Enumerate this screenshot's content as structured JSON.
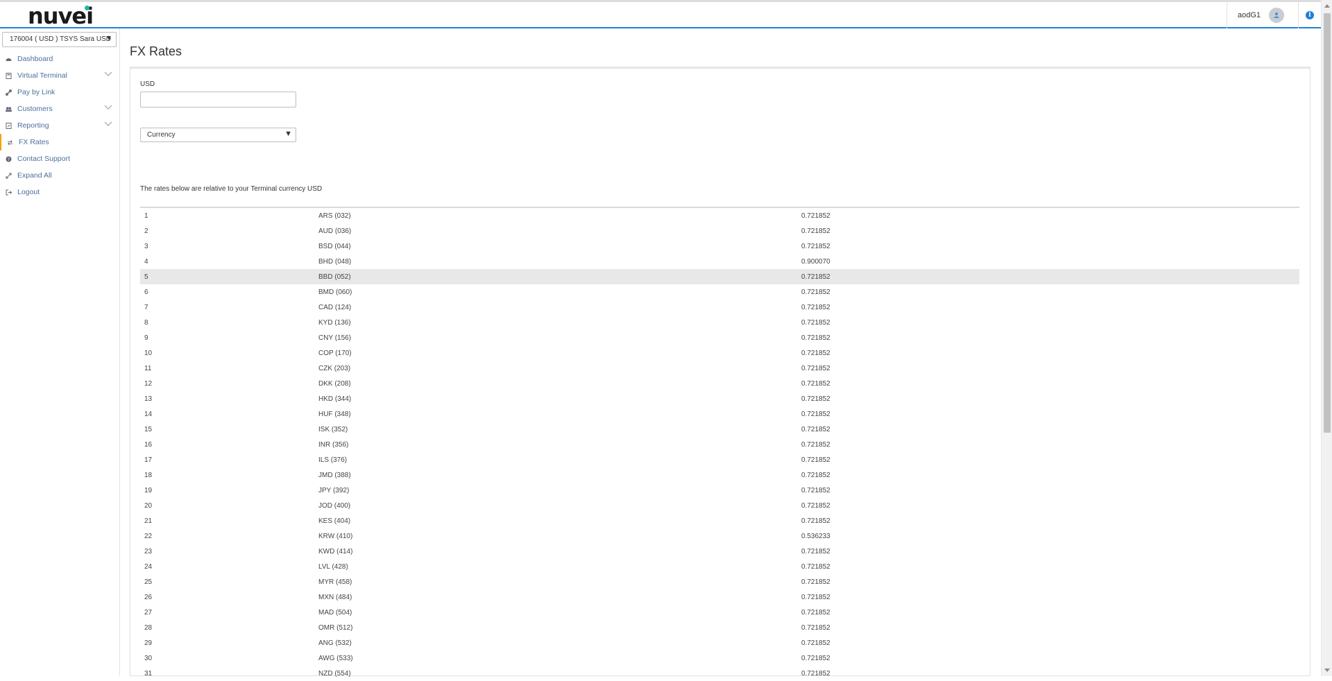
{
  "header": {
    "logo": "nuvei",
    "username": "aodG1"
  },
  "sidebar": {
    "terminal": "176004 ( USD ) TSYS Sara USD",
    "items": [
      {
        "label": "Dashboard",
        "icon": "dashboard-icon"
      },
      {
        "label": "Virtual Terminal",
        "icon": "calculator-icon"
      },
      {
        "label": "Pay by Link",
        "icon": "link-icon"
      },
      {
        "label": "Customers",
        "icon": "users-icon"
      },
      {
        "label": "Reporting",
        "icon": "report-icon"
      },
      {
        "label": "FX Rates",
        "icon": "exchange-icon"
      },
      {
        "label": "Contact Support",
        "icon": "help-icon"
      },
      {
        "label": "Expand All",
        "icon": "expand-icon"
      },
      {
        "label": "Logout",
        "icon": "logout-icon"
      }
    ]
  },
  "main": {
    "title": "FX Rates",
    "amount_label": "USD",
    "amount_value": "",
    "currency_select": "Currency",
    "note": "The rates below are relative to your Terminal currency USD"
  },
  "rates": [
    {
      "idx": "1",
      "code": "ARS (032)",
      "rate": "0.721852"
    },
    {
      "idx": "2",
      "code": "AUD (036)",
      "rate": "0.721852"
    },
    {
      "idx": "3",
      "code": "BSD (044)",
      "rate": "0.721852"
    },
    {
      "idx": "4",
      "code": "BHD (048)",
      "rate": "0.900070"
    },
    {
      "idx": "5",
      "code": "BBD (052)",
      "rate": "0.721852"
    },
    {
      "idx": "6",
      "code": "BMD (060)",
      "rate": "0.721852"
    },
    {
      "idx": "7",
      "code": "CAD (124)",
      "rate": "0.721852"
    },
    {
      "idx": "8",
      "code": "KYD (136)",
      "rate": "0.721852"
    },
    {
      "idx": "9",
      "code": "CNY (156)",
      "rate": "0.721852"
    },
    {
      "idx": "10",
      "code": "COP (170)",
      "rate": "0.721852"
    },
    {
      "idx": "11",
      "code": "CZK (203)",
      "rate": "0.721852"
    },
    {
      "idx": "12",
      "code": "DKK (208)",
      "rate": "0.721852"
    },
    {
      "idx": "13",
      "code": "HKD (344)",
      "rate": "0.721852"
    },
    {
      "idx": "14",
      "code": "HUF (348)",
      "rate": "0.721852"
    },
    {
      "idx": "15",
      "code": "ISK (352)",
      "rate": "0.721852"
    },
    {
      "idx": "16",
      "code": "INR (356)",
      "rate": "0.721852"
    },
    {
      "idx": "17",
      "code": "ILS (376)",
      "rate": "0.721852"
    },
    {
      "idx": "18",
      "code": "JMD (388)",
      "rate": "0.721852"
    },
    {
      "idx": "19",
      "code": "JPY (392)",
      "rate": "0.721852"
    },
    {
      "idx": "20",
      "code": "JOD (400)",
      "rate": "0.721852"
    },
    {
      "idx": "21",
      "code": "KES (404)",
      "rate": "0.721852"
    },
    {
      "idx": "22",
      "code": "KRW (410)",
      "rate": "0.536233"
    },
    {
      "idx": "23",
      "code": "KWD (414)",
      "rate": "0.721852"
    },
    {
      "idx": "24",
      "code": "LVL (428)",
      "rate": "0.721852"
    },
    {
      "idx": "25",
      "code": "MYR (458)",
      "rate": "0.721852"
    },
    {
      "idx": "26",
      "code": "MXN (484)",
      "rate": "0.721852"
    },
    {
      "idx": "27",
      "code": "MAD (504)",
      "rate": "0.721852"
    },
    {
      "idx": "28",
      "code": "OMR (512)",
      "rate": "0.721852"
    },
    {
      "idx": "29",
      "code": "ANG (532)",
      "rate": "0.721852"
    },
    {
      "idx": "30",
      "code": "AWG (533)",
      "rate": "0.721852"
    },
    {
      "idx": "31",
      "code": "NZD (554)",
      "rate": "0.721852"
    }
  ],
  "colors": {
    "accent": "#1f7fd6",
    "active_marker": "#f0a500",
    "nav_text": "#4a6f9c",
    "logo_dot": "#2bb39b"
  }
}
